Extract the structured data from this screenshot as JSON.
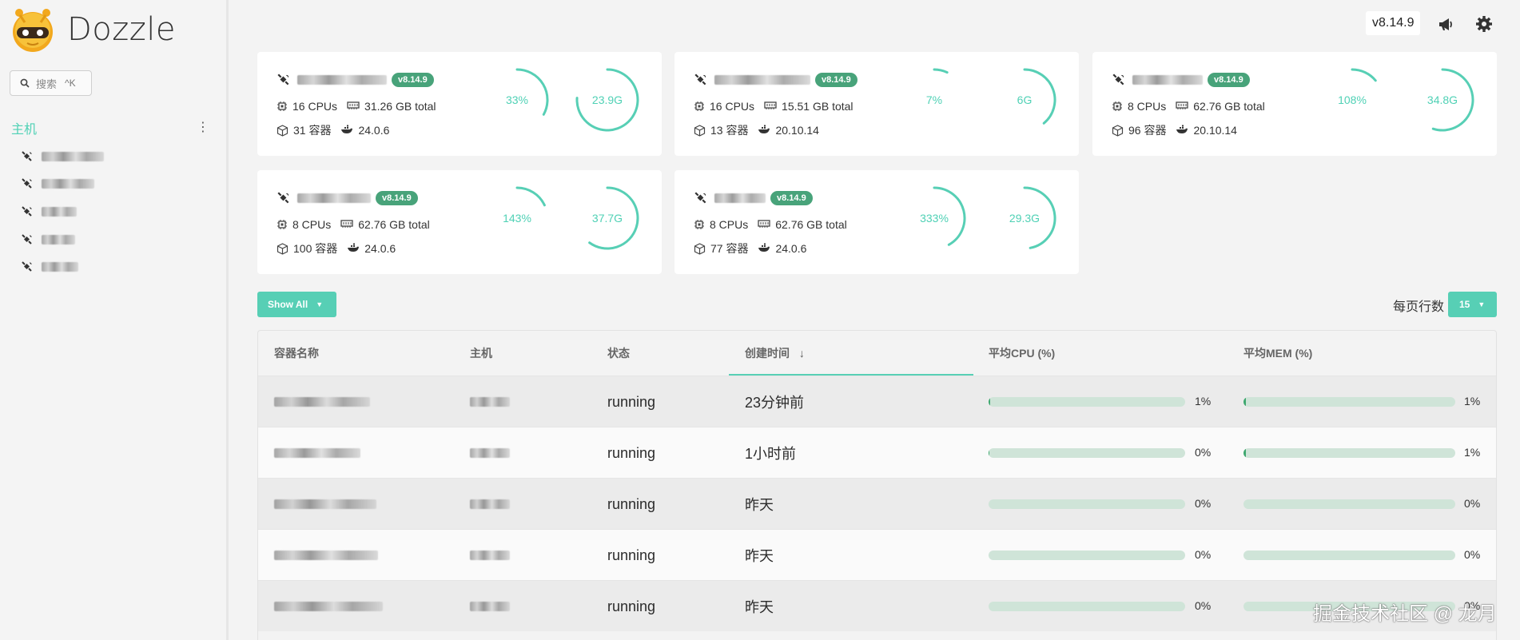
{
  "app": {
    "name": "Dozzle",
    "version": "v8.14.9"
  },
  "search": {
    "label": "搜索",
    "shortcut": "^K"
  },
  "sidebar": {
    "section_title": "主机",
    "hosts": [
      {
        "icon": "satellite-icon"
      },
      {
        "icon": "satellite-icon"
      },
      {
        "icon": "satellite-icon"
      },
      {
        "icon": "satellite-icon"
      },
      {
        "icon": "satellite-icon"
      }
    ]
  },
  "header": {
    "version": "v8.14.9",
    "announce_icon": "megaphone-icon",
    "settings_icon": "gear-icon"
  },
  "host_cards": [
    {
      "badge": "v8.14.9",
      "cpus": "16 CPUs",
      "mem": "31.26 GB total",
      "containers": "31 容器",
      "docker": "24.0.6",
      "cpu_label": "33%",
      "cpu_pct": 33,
      "mem_label": "23.9G",
      "mem_pct": 76
    },
    {
      "badge": "v8.14.9",
      "cpus": "16 CPUs",
      "mem": "15.51 GB total",
      "containers": "13 容器",
      "docker": "20.10.14",
      "cpu_label": "7%",
      "cpu_pct": 7,
      "mem_label": "6G",
      "mem_pct": 39
    },
    {
      "badge": "v8.14.9",
      "cpus": "8 CPUs",
      "mem": "62.76 GB total",
      "containers": "96 容器",
      "docker": "20.10.14",
      "cpu_label": "108%",
      "cpu_pct": 14,
      "mem_label": "34.8G",
      "mem_pct": 55
    },
    {
      "badge": "v8.14.9",
      "cpus": "8 CPUs",
      "mem": "62.76 GB total",
      "containers": "100 容器",
      "docker": "24.0.6",
      "cpu_label": "143%",
      "cpu_pct": 18,
      "mem_label": "37.7G",
      "mem_pct": 60
    },
    {
      "badge": "v8.14.9",
      "cpus": "8 CPUs",
      "mem": "62.76 GB total",
      "containers": "77 容器",
      "docker": "24.0.6",
      "cpu_label": "333%",
      "cpu_pct": 42,
      "mem_label": "29.3G",
      "mem_pct": 47
    }
  ],
  "controls": {
    "show_all": "Show All",
    "per_page_label": "每页行数",
    "per_page_value": "15"
  },
  "table": {
    "headers": {
      "name": "容器名称",
      "host": "主机",
      "state": "状态",
      "created": "创建时间",
      "cpu": "平均CPU (%)",
      "mem": "平均MEM (%)"
    },
    "rows": [
      {
        "state": "running",
        "created": "23分钟前",
        "cpu": "1%",
        "cpu_pct": 1,
        "mem": "1%",
        "mem_pct": 1
      },
      {
        "state": "running",
        "created": "1小时前",
        "cpu": "0%",
        "cpu_pct": 0.5,
        "mem": "1%",
        "mem_pct": 1
      },
      {
        "state": "running",
        "created": "昨天",
        "cpu": "0%",
        "cpu_pct": 0,
        "mem": "0%",
        "mem_pct": 0
      },
      {
        "state": "running",
        "created": "昨天",
        "cpu": "0%",
        "cpu_pct": 0,
        "mem": "0%",
        "mem_pct": 0
      },
      {
        "state": "running",
        "created": "昨天",
        "cpu": "0%",
        "cpu_pct": 0,
        "mem": "0%",
        "mem_pct": 0
      }
    ]
  },
  "watermark": "掘金技术社区 @ 龙月",
  "colors": {
    "accent": "#57cfb5",
    "badge": "#48a37a",
    "bar_fill": "#3ea86f",
    "bar_track": "#cfe4d8"
  }
}
